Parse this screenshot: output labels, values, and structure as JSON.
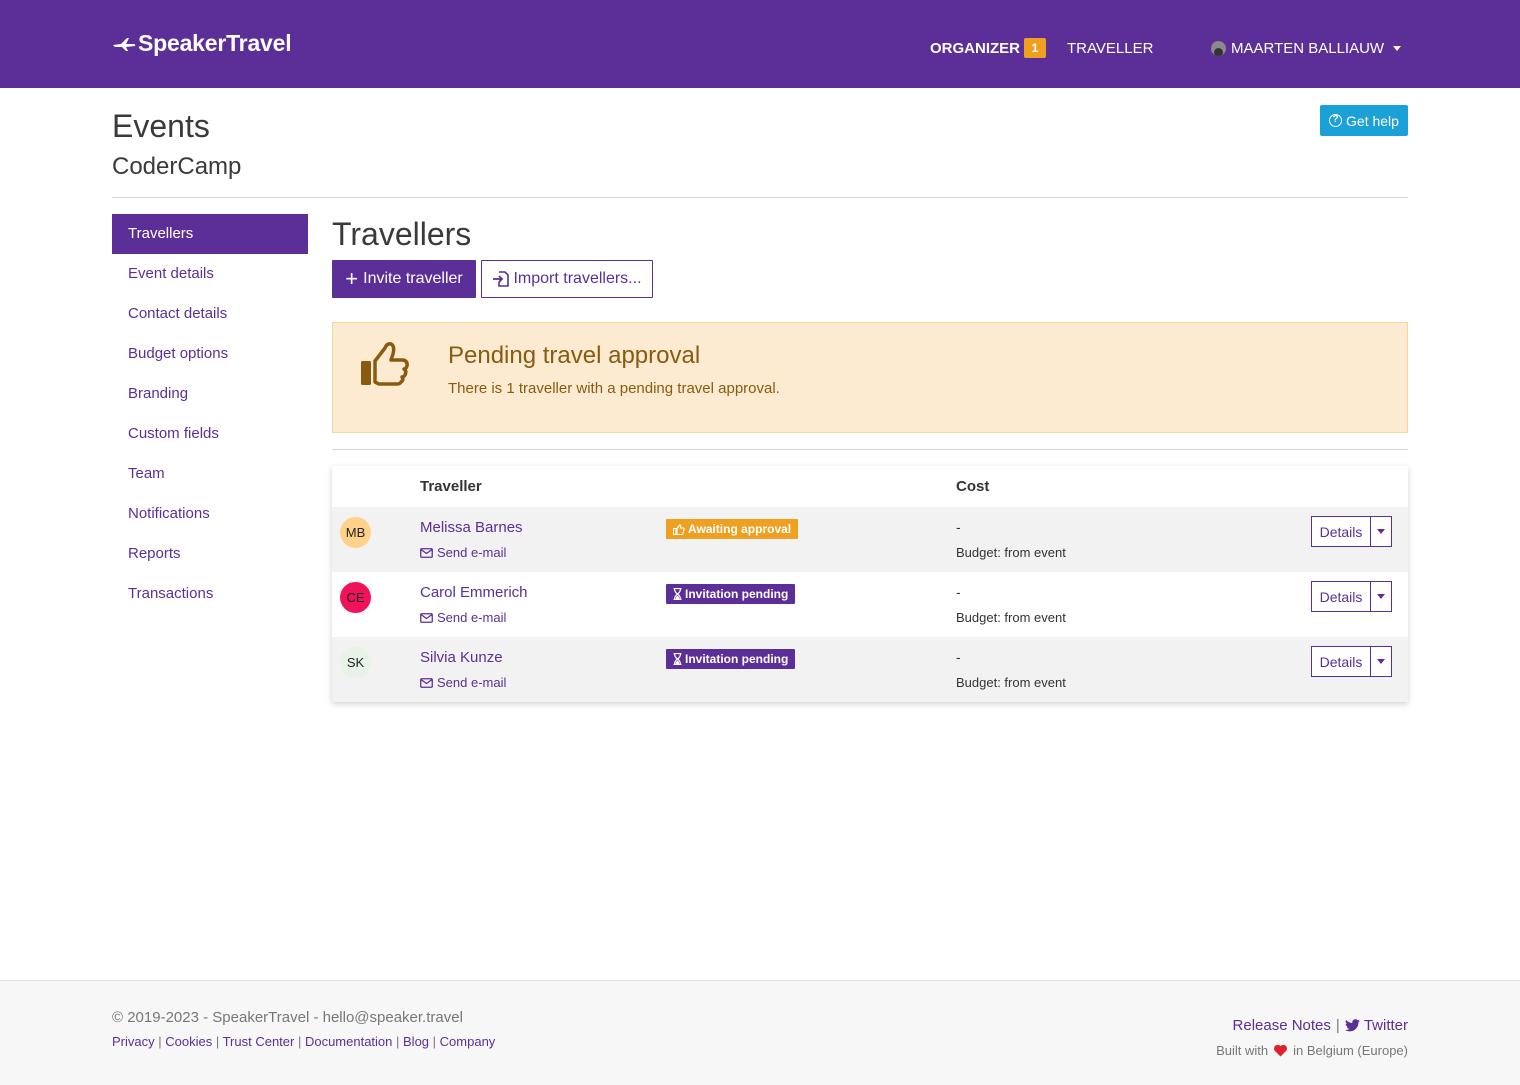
{
  "brand": {
    "name": "SpeakerTravel"
  },
  "nav": {
    "organizer": "ORGANIZER",
    "organizer_badge": "1",
    "traveller": "TRAVELLER",
    "user": "MAARTEN BALLIAUW"
  },
  "header": {
    "title": "Events",
    "event_name": "CoderCamp",
    "help_button": "Get help"
  },
  "sidebar": {
    "items": [
      {
        "label": "Travellers",
        "active": true
      },
      {
        "label": "Event details"
      },
      {
        "label": "Contact details"
      },
      {
        "label": "Budget options"
      },
      {
        "label": "Branding"
      },
      {
        "label": "Custom fields"
      },
      {
        "label": "Team"
      },
      {
        "label": "Notifications"
      },
      {
        "label": "Reports"
      },
      {
        "label": "Transactions"
      }
    ]
  },
  "main": {
    "title": "Travellers",
    "invite_button": "Invite traveller",
    "import_button": "Import travellers...",
    "alert": {
      "title": "Pending travel approval",
      "text": "There is 1 traveller with a pending travel approval."
    },
    "table": {
      "headers": {
        "traveller": "Traveller",
        "cost": "Cost"
      },
      "rows": [
        {
          "initials": "MB",
          "avatar_color": "#ffd28a",
          "name": "Melissa Barnes",
          "email_label": "Send e-mail",
          "status": "Awaiting approval",
          "status_color": "#f0a020",
          "status_icon": "thumbs-up-icon",
          "cost": "-",
          "budget": "Budget: from event",
          "action": "Details"
        },
        {
          "initials": "CE",
          "avatar_color": "#f0135a",
          "name": "Carol Emmerich",
          "email_label": "Send e-mail",
          "status": "Invitation pending",
          "status_color": "#5b2f97",
          "status_icon": "hourglass-icon",
          "cost": "-",
          "budget": "Budget: from event",
          "action": "Details"
        },
        {
          "initials": "SK",
          "avatar_color": "#e6f3e6",
          "name": "Silvia Kunze",
          "email_label": "Send e-mail",
          "status": "Invitation pending",
          "status_color": "#5b2f97",
          "status_icon": "hourglass-icon",
          "cost": "-",
          "budget": "Budget: from event",
          "action": "Details"
        }
      ]
    }
  },
  "footer": {
    "copyright": "© 2019-2023 - SpeakerTravel - hello@speaker.travel",
    "links": [
      "Privacy",
      "Cookies",
      "Trust Center",
      "Documentation",
      "Blog",
      "Company"
    ],
    "release_notes": "Release Notes",
    "twitter": "Twitter",
    "built_prefix": "Built with",
    "built_suffix": "in Belgium (Europe)"
  },
  "colors": {
    "brand": "#5b2f97",
    "warning": "#f0a020",
    "info": "#1ba0d8",
    "alert_bg": "#fcebd0"
  }
}
